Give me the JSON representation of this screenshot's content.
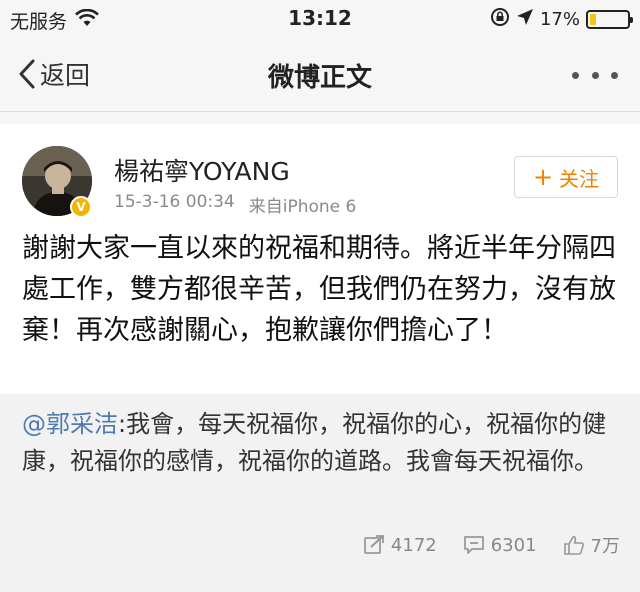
{
  "status_bar": {
    "carrier": "无服务",
    "time": "13:12",
    "battery": "17%",
    "battery_level": 0.17
  },
  "nav": {
    "back_label": "返回",
    "title": "微博正文"
  },
  "post": {
    "username": "楊祐寧YOYANG",
    "date": "15-3-16 00:34",
    "source": "来自iPhone 6",
    "follow_label": "关注",
    "text": "謝謝大家一直以來的祝福和期待。將近半年分隔四處工作，雙方都很辛苦，但我們仍在努力，沒有放棄！再次感謝關心，抱歉讓你們擔心了！",
    "verified_badge": "V"
  },
  "repost": {
    "mention": "@郭采洁",
    "text": ":我會，每天祝福你，祝福你的心，祝福你的健康，祝福你的感情，祝福你的道路。我會每天祝福你。",
    "reposts": "4172",
    "comments": "6301",
    "likes": "7万"
  },
  "colors": {
    "accent_orange": "#f08200",
    "link_blue": "#4f7cb0",
    "badge_gold": "#f5b400",
    "battery_fill": "#f5c518"
  },
  "icons": {
    "wifi": "wifi-icon",
    "lock": "orientation-lock-icon",
    "location": "location-arrow-icon",
    "back": "chevron-left-icon",
    "more": "more-dots-icon",
    "repost": "repost-icon",
    "comment": "comment-icon",
    "like": "thumbs-up-icon"
  }
}
